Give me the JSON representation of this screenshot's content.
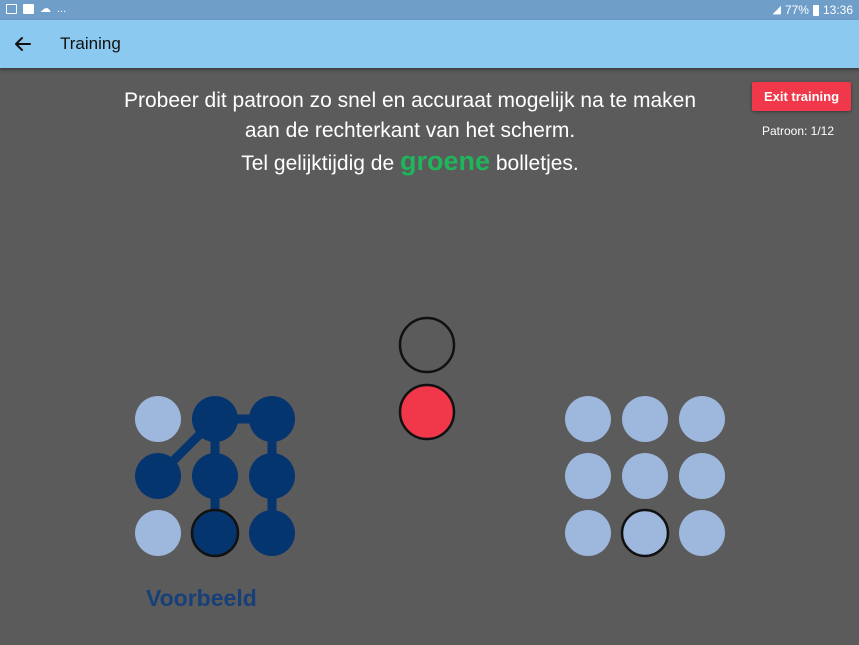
{
  "status_bar": {
    "left_icons": [
      "image-icon",
      "flipboard-icon",
      "weather-icon"
    ],
    "overflow": "...",
    "battery": "77%",
    "time": "13:36"
  },
  "app_bar": {
    "title": "Training",
    "back_icon": "arrow-left-icon"
  },
  "instructions": {
    "line1": "Probeer dit patroon zo snel en accuraat mogelijk na te maken",
    "line2": "aan de rechterkant van het scherm.",
    "line3_before": "Tel gelijktijdig de ",
    "line3_highlight": "groene",
    "line3_after": " bolletjes."
  },
  "exit_button": {
    "label": "Exit training"
  },
  "pattern_counter": "Patroon: 1/12",
  "example_label": "Voorbeeld",
  "example_grid": {
    "active": [
      1,
      2,
      3,
      4,
      5,
      7,
      8
    ],
    "highlight": 7,
    "connections": [
      [
        1,
        2
      ],
      [
        1,
        3
      ],
      [
        2,
        5
      ],
      [
        4,
        1
      ],
      [
        4,
        7
      ],
      [
        5,
        8
      ]
    ]
  },
  "input_grid": {
    "highlight": 7
  },
  "indicator": {
    "top": "empty",
    "bottom": "red"
  },
  "colors": {
    "background": "#5b5b5b",
    "status_bar": "#6f9ec9",
    "app_bar": "#8cc9f0",
    "dot_inactive": "#9db8dc",
    "dot_active": "#05356e",
    "highlight_text": "#1fb55b",
    "exit_button": "#f0384a",
    "indicator_red": "#f0384a",
    "example_label": "#173f78"
  }
}
